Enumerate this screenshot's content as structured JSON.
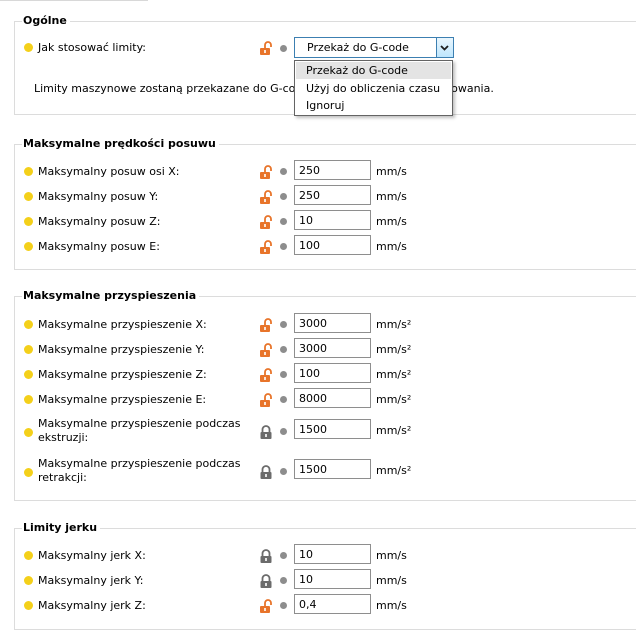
{
  "sections": {
    "general": {
      "title": "Ogólne",
      "mode_label": "Jak stosować limity:",
      "mode_value": "Przekaż do G-code",
      "info_before": "Limity maszynowe zostaną przekazane do G-code",
      "info_after": "ukowania.",
      "dropdown_options": [
        "Przekaż do G-code",
        "Użyj do obliczenia czasu",
        "Ignoruj"
      ]
    },
    "feedrates": {
      "title": "Maksymalne prędkości posuwu",
      "rows": [
        {
          "label": "Maksymalny posuw osi X:",
          "value": "250",
          "unit": "mm/s",
          "lock": "unlocked"
        },
        {
          "label": "Maksymalny posuw Y:",
          "value": "250",
          "unit": "mm/s",
          "lock": "unlocked"
        },
        {
          "label": "Maksymalny posuw Z:",
          "value": "10",
          "unit": "mm/s",
          "lock": "unlocked"
        },
        {
          "label": "Maksymalny posuw E:",
          "value": "100",
          "unit": "mm/s",
          "lock": "unlocked"
        }
      ]
    },
    "accelerations": {
      "title": "Maksymalne przyspieszenia",
      "rows": [
        {
          "label": "Maksymalne przyspieszenie X:",
          "value": "3000",
          "unit": "mm/s²",
          "lock": "unlocked"
        },
        {
          "label": "Maksymalne przyspieszenie Y:",
          "value": "3000",
          "unit": "mm/s²",
          "lock": "unlocked"
        },
        {
          "label": "Maksymalne przyspieszenie Z:",
          "value": "100",
          "unit": "mm/s²",
          "lock": "unlocked"
        },
        {
          "label": "Maksymalne przyspieszenie E:",
          "value": "8000",
          "unit": "mm/s²",
          "lock": "unlocked"
        },
        {
          "label_line1": "Maksymalne przyspieszenie podczas",
          "label_line2": "ekstruzji:",
          "value": "1500",
          "unit": "mm/s²",
          "lock": "locked"
        },
        {
          "label_line1": "Maksymalne przyspieszenie podczas",
          "label_line2": "retrakcji:",
          "value": "1500",
          "unit": "mm/s²",
          "lock": "locked"
        }
      ]
    },
    "jerk": {
      "title": "Limity jerku",
      "rows": [
        {
          "label": "Maksymalny jerk X:",
          "value": "10",
          "unit": "mm/s",
          "lock": "locked"
        },
        {
          "label": "Maksymalny jerk Y:",
          "value": "10",
          "unit": "mm/s",
          "lock": "locked"
        },
        {
          "label": "Maksymalny jerk Z:",
          "value": "0,4",
          "unit": "mm/s",
          "lock": "unlocked"
        }
      ]
    }
  },
  "colors": {
    "modified_dot": "#f4d01a",
    "unlocked_icon": "#e8742a",
    "locked_icon": "#6b6b6b",
    "system_dot": "#8d8d8d",
    "combo_border": "#3c7fb1"
  }
}
